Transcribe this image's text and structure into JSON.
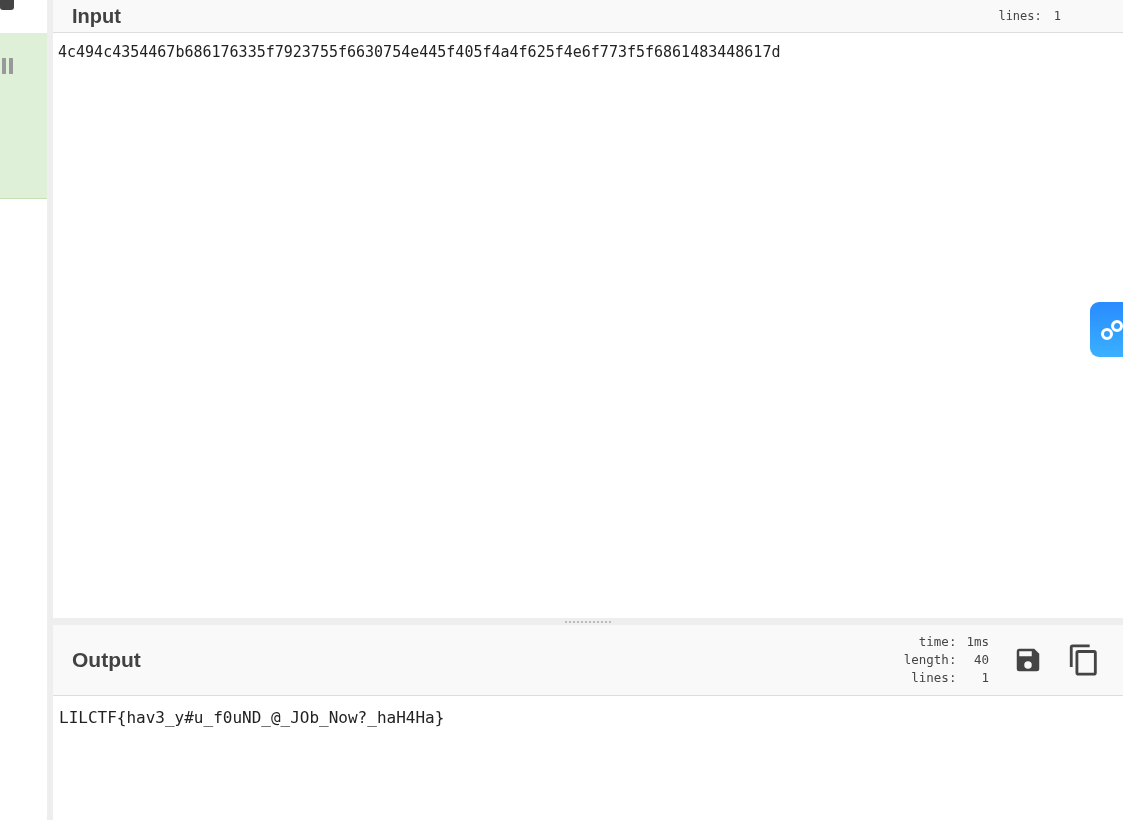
{
  "input": {
    "title": "Input",
    "stats": [
      {
        "label": "lines:",
        "value": "1"
      }
    ],
    "value": "4c494c4354467b686176335f7923755f6630754e445f405f4a4f625f4e6f773f5f6861483448617d"
  },
  "output": {
    "title": "Output",
    "stats": [
      {
        "label": "time:",
        "value": "1ms"
      },
      {
        "label": "length:",
        "value": "40"
      },
      {
        "label": "lines:",
        "value": "1"
      }
    ],
    "value": "LILCTF{hav3_y#u_f0uND_@_JOb_Now?_haH4Ha}"
  }
}
